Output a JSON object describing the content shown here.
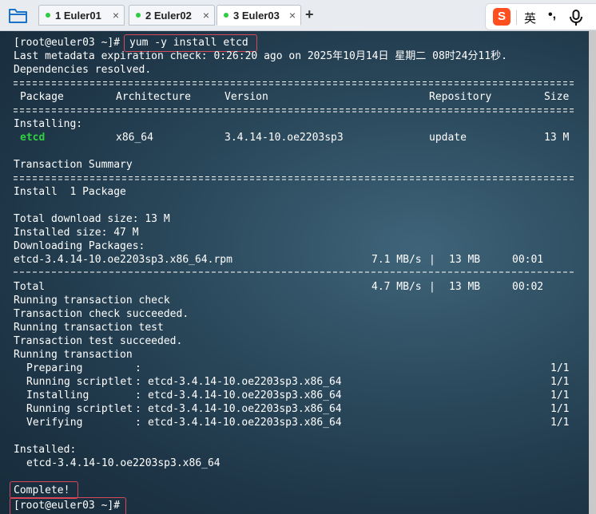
{
  "tabs": [
    {
      "label": "1 Euler01",
      "close": "×"
    },
    {
      "label": "2 Euler02",
      "close": "×"
    },
    {
      "label": "3 Euler03",
      "close": "×"
    }
  ],
  "new_tab": "+",
  "ime": {
    "logo": "S",
    "mode": "英",
    "punct": "•,"
  },
  "terminal": {
    "l1_prompt": "[root@euler03 ~]#",
    "l1_cmd": "yum -y install etcd",
    "l2": "Last metadata expiration check: 0:26:20 ago on 2025年10月14日 星期二 08时24分11秒.",
    "l3": "Dependencies resolved.",
    "header": {
      "package": "Package",
      "architecture": "Architecture",
      "version": "Version",
      "repository": "Repository",
      "size": "Size"
    },
    "installing": "Installing:",
    "row": {
      "package": "etcd",
      "arch": "x86_64",
      "version": "3.4.14-10.oe2203sp3",
      "repo": "update",
      "size": "13 M"
    },
    "transaction_summary": "Transaction Summary",
    "install_count": "Install  1 Package",
    "total_download": "Total download size: 13 M",
    "installed_size": "Installed size: 47 M",
    "downloading": "Downloading Packages:",
    "dl_file": "etcd-3.4.14-10.oe2203sp3.x86_64.rpm",
    "dl_rate": "7.1 MB/s",
    "dl_size": "13 MB",
    "dl_time": "00:01",
    "total_label": "Total",
    "total_rate": "4.7 MB/s",
    "total_size": "13 MB",
    "total_time": "00:02",
    "running_check": "Running transaction check",
    "check_ok": "Transaction check succeeded.",
    "running_test": "Running transaction test",
    "test_ok": "Transaction test succeeded.",
    "running_tx": "Running transaction",
    "steps": [
      {
        "name": "Preparing",
        "pkg": "",
        "count": "1/1"
      },
      {
        "name": "Running scriptlet",
        "pkg": "etcd-3.4.14-10.oe2203sp3.x86_64",
        "count": "1/1"
      },
      {
        "name": "Installing",
        "pkg": "etcd-3.4.14-10.oe2203sp3.x86_64",
        "count": "1/1"
      },
      {
        "name": "Running scriptlet",
        "pkg": "etcd-3.4.14-10.oe2203sp3.x86_64",
        "count": "1/1"
      },
      {
        "name": "Verifying",
        "pkg": "etcd-3.4.14-10.oe2203sp3.x86_64",
        "count": "1/1"
      }
    ],
    "installed_label": "Installed:",
    "installed_pkg": "etcd-3.4.14-10.oe2203sp3.x86_64",
    "complete": "Complete!",
    "final_prompt": "[root@euler03 ~]#"
  },
  "colors": {
    "package_name": "#2fd03f",
    "highlight": "#d6485a",
    "active_tab_dot": "#2ecc40"
  }
}
